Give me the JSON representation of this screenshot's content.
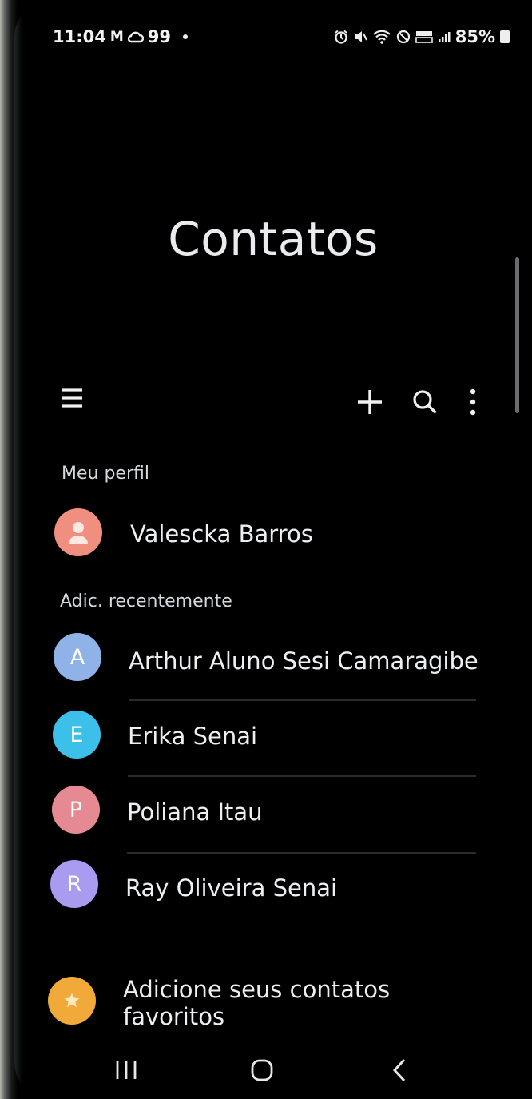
{
  "status_bar": {
    "time": "11:04",
    "notifications": "M",
    "notif_count": "99",
    "battery": "85%"
  },
  "header": {
    "title": "Contatos"
  },
  "toolbar": {
    "menu_icon": "hamburger-menu-icon",
    "add_icon": "plus-icon",
    "search_icon": "search-icon",
    "more_icon": "more-vertical-icon"
  },
  "profile_section": {
    "label": "Meu perfil",
    "name": "Valescka Barros"
  },
  "recent_section": {
    "label": "Adic. recentemente",
    "contacts": [
      {
        "initial": "A",
        "name": "Arthur Aluno Sesi Camaragibe",
        "color": "#8fb3e8"
      },
      {
        "initial": "E",
        "name": "Erika Senai",
        "color": "#3cc0ea"
      },
      {
        "initial": "P",
        "name": "Poliana Itau",
        "color": "#e58a92"
      },
      {
        "initial": "R",
        "name": "Ray Oliveira Senai",
        "color": "#a99bef"
      }
    ]
  },
  "favorites": {
    "line1": "Adicione seus contatos",
    "line2": "favoritos",
    "color": "#f1a93a"
  },
  "colors": {
    "profile_avatar": "#f08f80",
    "background": "#000000"
  }
}
